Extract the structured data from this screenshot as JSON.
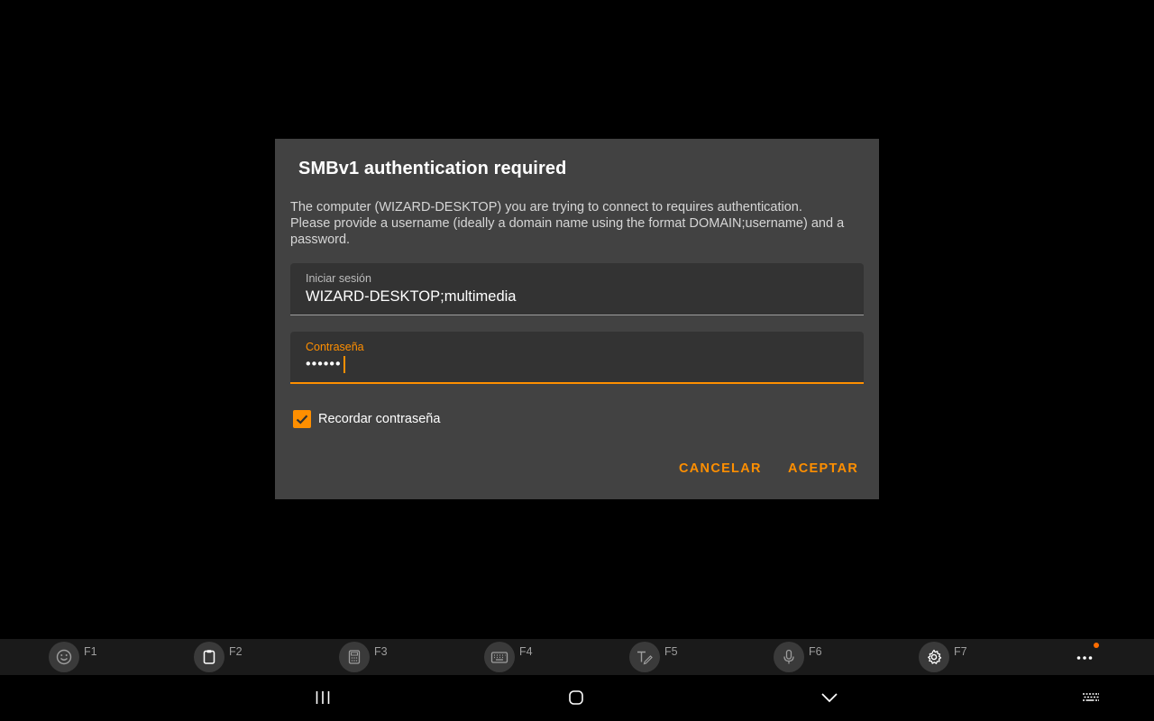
{
  "dialog": {
    "title": "SMBv1 authentication required",
    "message_line1": "The computer (WIZARD-DESKTOP) you are trying to connect to requires authentication.",
    "message_line2": "Please provide a username (ideally a domain name using the format DOMAIN;username) and a",
    "message_line3": "password.",
    "username_label": "Iniciar sesión",
    "username_value": "WIZARD-DESKTOP;multimedia",
    "password_label": "Contraseña",
    "password_value": "••••••",
    "remember_label": "Recordar contraseña",
    "remember_checked": true,
    "cancel_label": "CANCELAR",
    "ok_label": "ACEPTAR",
    "accent_color": "#ff8f00"
  },
  "fkeys": [
    {
      "label": "F1",
      "icon": "emoji-icon"
    },
    {
      "label": "F2",
      "icon": "clipboard-icon"
    },
    {
      "label": "F3",
      "icon": "keypad-icon"
    },
    {
      "label": "F4",
      "icon": "keyboard-icon"
    },
    {
      "label": "F5",
      "icon": "handwriting-icon"
    },
    {
      "label": "F6",
      "icon": "microphone-icon"
    },
    {
      "label": "F7",
      "icon": "gear-icon"
    }
  ],
  "navbar": {
    "buttons": [
      "recent-apps-icon",
      "home-icon",
      "back-chevron-icon",
      "keyboard-switch-icon"
    ]
  }
}
